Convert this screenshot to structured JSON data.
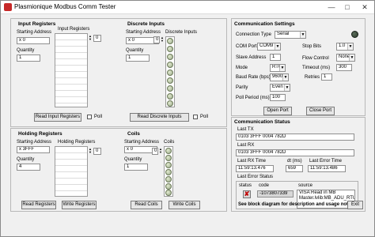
{
  "window": {
    "title": "Plasmionique Modbus Comm Tester",
    "buttons": {
      "minimize": "—",
      "maximize": "□",
      "close": "✕"
    }
  },
  "input_registers": {
    "title": "Input Registers",
    "start_label": "Starting Address",
    "start_value": "0",
    "qty_label": "Quantity",
    "qty_value": "1",
    "list_label": "Input Registers",
    "index_value": "0",
    "button": "Read Input Registers",
    "poll_label": "Poll"
  },
  "discrete_inputs": {
    "title": "Discrete Inputs",
    "start_label": "Starting Address",
    "start_value": "0",
    "qty_label": "Quantity",
    "qty_value": "1",
    "list_label": "Discrete Inputs",
    "index_value": "0",
    "button": "Read Discrete Inputs",
    "poll_label": "Poll"
  },
  "holding_registers": {
    "title": "Holding Registers",
    "start_label": "Starting Address",
    "start_value": "3FFF",
    "qty_label": "Quantity",
    "qty_value": "4",
    "list_label": "Holding Registers",
    "index_value": "0",
    "read_button": "Read Registers",
    "write_button": "Write Registers"
  },
  "coils": {
    "title": "Coils",
    "start_label": "Starting Address",
    "start_value": "0",
    "qty_label": "Quantity",
    "qty_value": "1",
    "list_label": "Coils",
    "index_value": "0",
    "read_button": "Read Coils",
    "write_button": "Write Coils"
  },
  "comm_settings": {
    "title": "Communication Settings",
    "connection_type_label": "Connection Type",
    "connection_type": "Serial",
    "com_port_label": "COM Port",
    "com_port": "COM9",
    "slave_address_label": "Slave Address",
    "slave_address": "1",
    "mode_label": "Mode",
    "mode": "RTU",
    "baud_label": "Baud Rate (bps)",
    "baud": "9600",
    "parity_label": "Parity",
    "parity": "Even",
    "poll_period_label": "Poll Period (ms)",
    "poll_period": "100",
    "stop_bits_label": "Stop Bits",
    "stop_bits": "1.0",
    "flow_control_label": "Flow Control",
    "flow_control": "None",
    "timeout_label": "Timeout (ms)",
    "timeout": "300",
    "retries_label": "Retries",
    "retries": "1",
    "open_port": "Open Port",
    "close_port": "Close Port"
  },
  "comm_status": {
    "title": "Communication Status",
    "last_tx_label": "Last TX",
    "last_tx": "0103 3FFF 0004 782D",
    "last_rx_label": "Last RX",
    "last_rx": "0103 3FFF 0004 782D",
    "last_rx_time_label": "Last RX Time",
    "last_rx_time": "11:59:13.476",
    "dt_label": "dt (ms)",
    "dt": "659",
    "last_error_time_label": "Last Error Time",
    "last_error_time": "11:59:13.486",
    "last_error_status_label": "Last Error Status",
    "status_label": "status",
    "code_label": "code",
    "code_value": "-1073807339",
    "source_label": "source",
    "source_value": "VISA Read in MB Master.lvlib:MB_ADU_RTU.lvclass:"
  },
  "footer": {
    "note": "See block diagram for description and usage notes.",
    "exit": "Exit"
  },
  "colors": {
    "led_off": "#9ba98b",
    "error_x": "#c00000",
    "indicator_dark": "#2e3b2e"
  }
}
